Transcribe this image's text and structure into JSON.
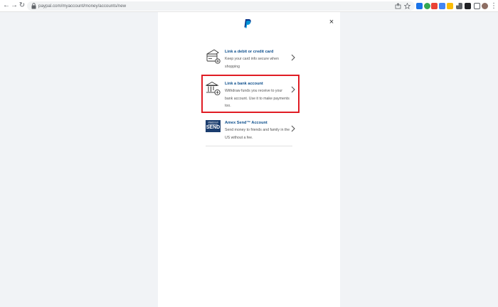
{
  "browser": {
    "url": "paypal.com/myaccount/money/accounts/new"
  },
  "modal": {
    "close_label": "×"
  },
  "options": [
    {
      "title": "Link a debit or credit card",
      "description": "Keep your card info secure when shopping"
    },
    {
      "title": "Link a bank account",
      "description": "Withdraw funds you receive to your bank account. Use it to make payments too."
    },
    {
      "title": "Amex Send™ Account",
      "description": "Send money to friends and family in the US without a fee.",
      "logo_top": "AMERICAN EXPRESS",
      "logo_text": "SEND"
    }
  ],
  "colors": {
    "link_blue": "#0c4e8c",
    "highlight_red": "#e01c24",
    "page_bg": "#f1f3f6",
    "amex_blue": "#1b3d6e"
  }
}
